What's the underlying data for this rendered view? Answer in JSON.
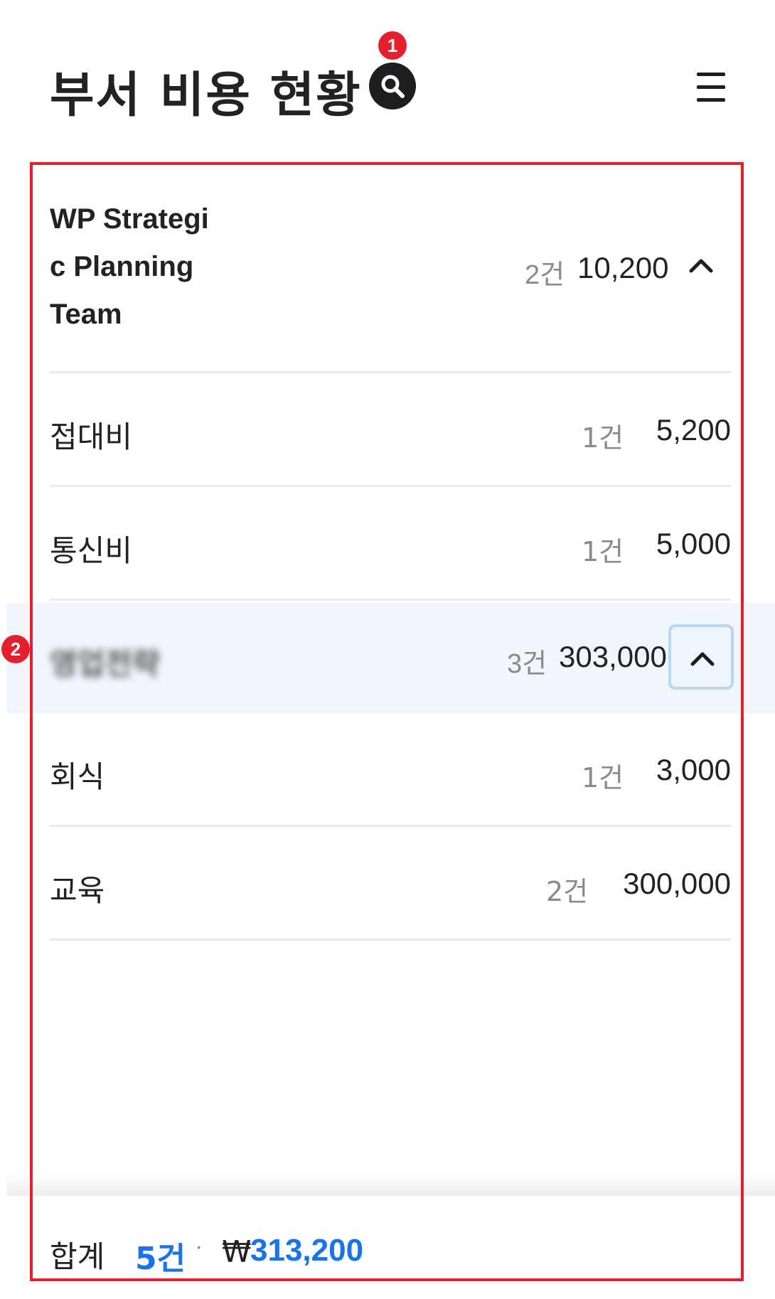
{
  "header": {
    "title": "부서 비용 현황",
    "search_icon": "search-icon",
    "menu_icon": "hamburger-menu-icon",
    "badge_search": "1"
  },
  "annotations": {
    "badge_group": "2",
    "frame_color": "#e3202b"
  },
  "groups": [
    {
      "name_lines": [
        "WP Strategi",
        "c Planning",
        "Team"
      ],
      "count": "2건",
      "amount": "10,200",
      "expanded": true,
      "items": [
        {
          "label": "접대비",
          "count": "1건",
          "amount": "5,200"
        },
        {
          "label": "통신비",
          "count": "1건",
          "amount": "5,000"
        }
      ]
    },
    {
      "name": "영업전략",
      "count": "3건",
      "amount": "303,000",
      "expanded": true,
      "focused": true,
      "items": [
        {
          "label": "회식",
          "count": "1건",
          "amount": "3,000"
        },
        {
          "label": "교육",
          "count": "2건",
          "amount": "300,000"
        }
      ]
    }
  ],
  "footer": {
    "label": "합계",
    "count": "5건",
    "separator": "·",
    "currency": "₩",
    "total": "313,200"
  },
  "colors": {
    "accent": "#1a73e8",
    "badge": "#e3202b",
    "highlight": "#f0f6fc"
  }
}
